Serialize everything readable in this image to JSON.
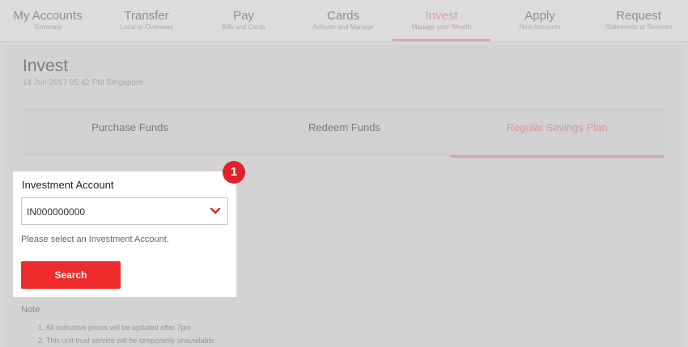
{
  "nav": [
    {
      "label": "My Accounts",
      "sub": "Summary"
    },
    {
      "label": "Transfer",
      "sub": "Local or Overseas"
    },
    {
      "label": "Pay",
      "sub": "Bills and Cards"
    },
    {
      "label": "Cards",
      "sub": "Activate and Manage"
    },
    {
      "label": "Invest",
      "sub": "Manage your Wealth",
      "active": true
    },
    {
      "label": "Apply",
      "sub": "New Accounts"
    },
    {
      "label": "Request",
      "sub": "Statements or Services"
    }
  ],
  "page": {
    "title": "Invest",
    "date": "14 Jun 2017 05:42 PM Singapore"
  },
  "subtabs": [
    {
      "label": "Purchase Funds"
    },
    {
      "label": "Redeem Funds"
    },
    {
      "label": "Regular Savings Plan",
      "active": true
    }
  ],
  "form": {
    "label": "Investment Account",
    "selected_value": "IN000000000",
    "helper": "Please select an Investment Account.",
    "search_label": "Search",
    "step_badge": "1"
  },
  "notes": {
    "title": "Note",
    "items": [
      "1. All indicative prices will be updated after 7pm",
      "2. This unit trust service will be temporarily unavailable:"
    ]
  },
  "colors": {
    "accent": "#ee2b2b",
    "badge": "#e2212a"
  }
}
